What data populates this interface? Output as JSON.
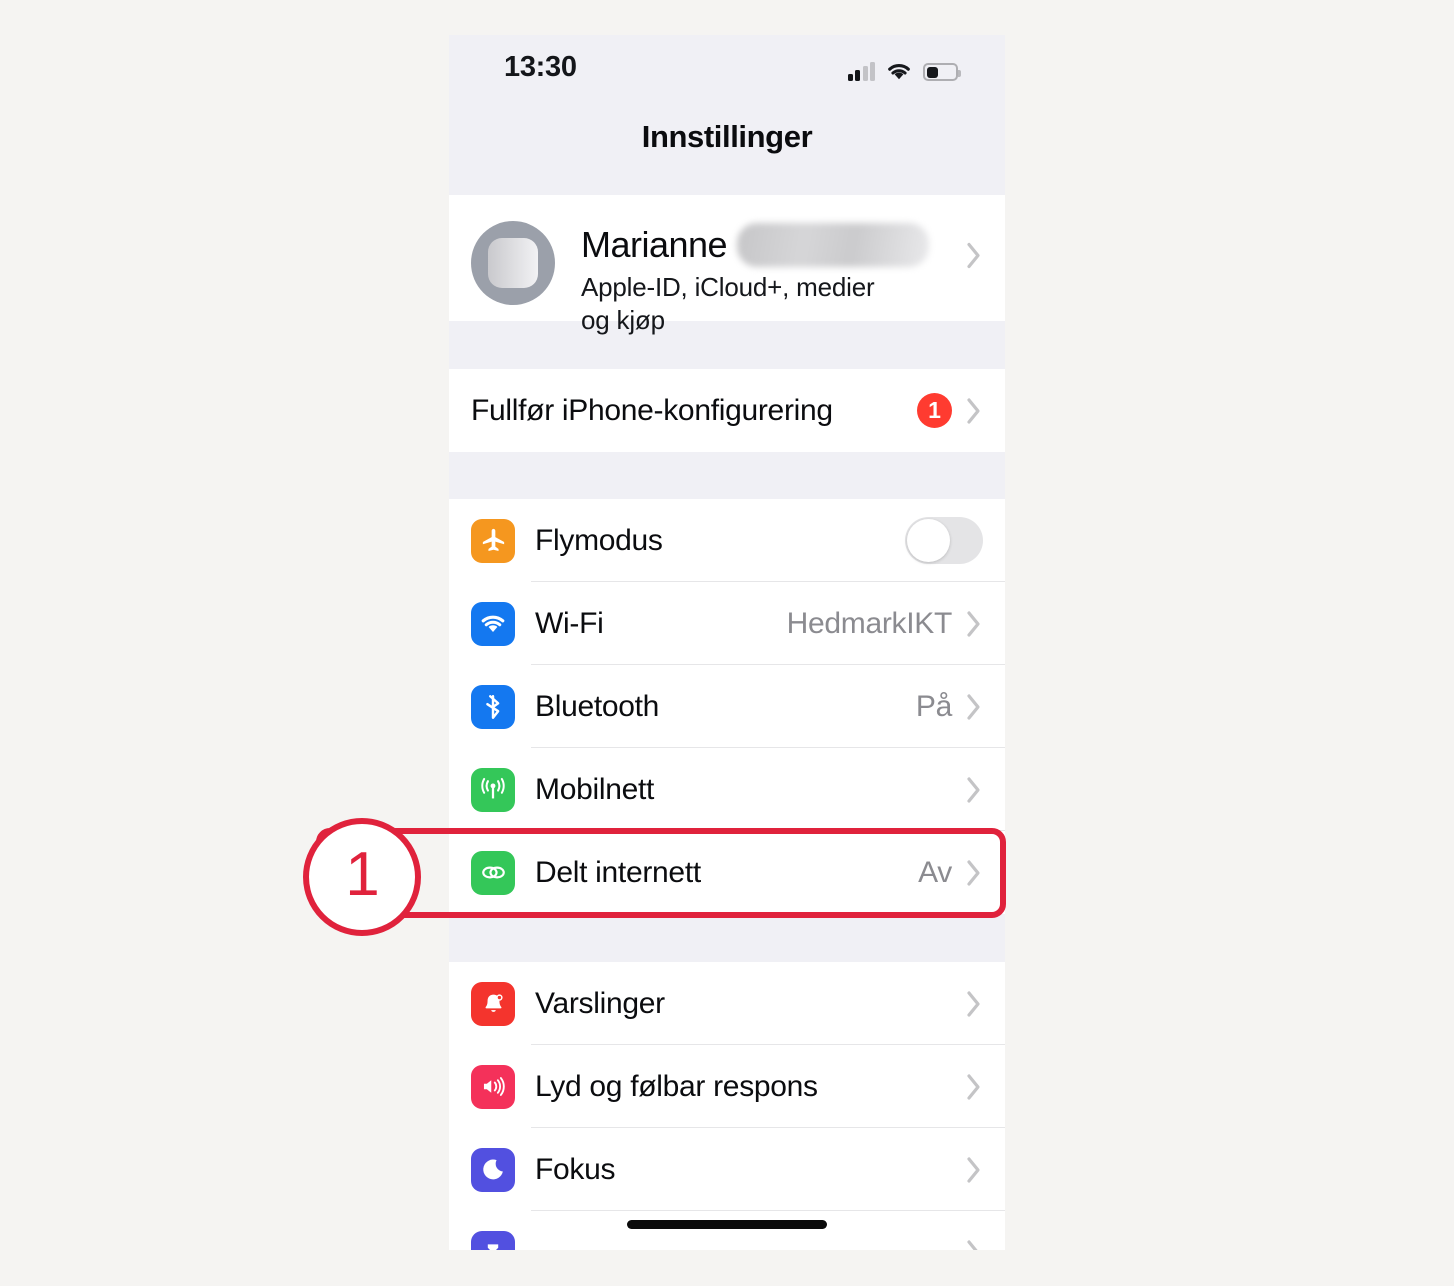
{
  "page": {
    "background_color": "#f5f4f2",
    "screen_background": "#f0f0f5"
  },
  "statusbar": {
    "time": "13:30",
    "signal_icon": "cellular-signal-icon",
    "wifi_icon": "wifi-icon",
    "battery_icon": "battery-icon"
  },
  "nav": {
    "title": "Innstillinger"
  },
  "apple_id": {
    "name": "Marianne",
    "name_redacted": true,
    "subtitle": "Apple-ID, iCloud+, medier og kjøp",
    "avatar_icon": "avatar",
    "chevron_icon": "chevron-right-icon"
  },
  "setup": {
    "label": "Fullfør iPhone-konfigurering",
    "badge": "1",
    "badge_color": "#ff3b30",
    "chevron_icon": "chevron-right-icon"
  },
  "connectivity": [
    {
      "id": "airplane-mode",
      "label": "Flymodus",
      "icon": "airplane-icon",
      "icon_color": "#f5971f",
      "control": "toggle",
      "toggle_on": false
    },
    {
      "id": "wifi",
      "label": "Wi-Fi",
      "icon": "wifi-icon",
      "icon_color": "#1478f0",
      "control": "value",
      "value": "HedmarkIKT"
    },
    {
      "id": "bluetooth",
      "label": "Bluetooth",
      "icon": "bluetooth-icon",
      "icon_color": "#1478f0",
      "control": "value",
      "value": "På"
    },
    {
      "id": "cellular",
      "label": "Mobilnett",
      "icon": "cellular-antenna-icon",
      "icon_color": "#34c759",
      "control": "value",
      "value": ""
    },
    {
      "id": "personal-hotspot",
      "label": "Delt internett",
      "icon": "chain-link-icon",
      "icon_color": "#34c759",
      "control": "value",
      "value": "Av"
    }
  ],
  "notifications_group": [
    {
      "id": "notifications",
      "label": "Varslinger",
      "icon": "bell-icon",
      "icon_color": "#f4342d",
      "value": ""
    },
    {
      "id": "sounds-haptics",
      "label": "Lyd og følbar respons",
      "icon": "speaker-icon",
      "icon_color": "#f4315a",
      "value": ""
    },
    {
      "id": "focus",
      "label": "Fokus",
      "icon": "moon-icon",
      "icon_color": "#5250e0",
      "value": ""
    },
    {
      "id": "screen-time",
      "label": "",
      "icon": "hourglass-icon",
      "icon_color": "#5250e0",
      "value": ""
    }
  ],
  "annotation": {
    "number": "1",
    "color": "#e0223c",
    "highlights_row": "Delt internett"
  },
  "home_indicator": "home-indicator-bar"
}
